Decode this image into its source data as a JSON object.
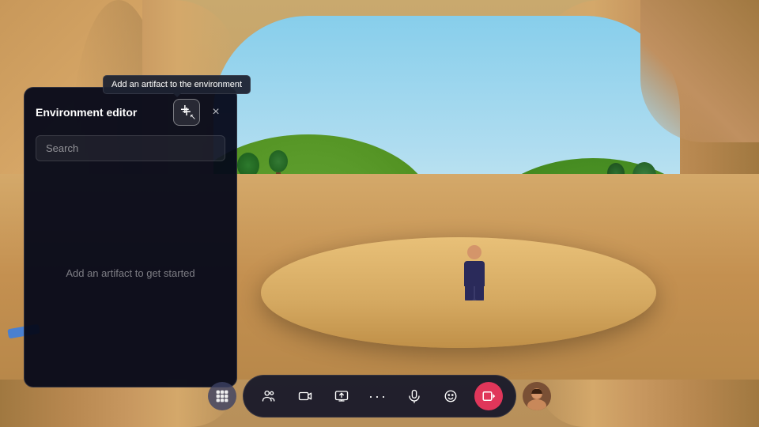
{
  "scene": {
    "bg_color": "#c9a96e"
  },
  "tooltip": {
    "text": "Add an artifact to the environment"
  },
  "env_panel": {
    "title": "Environment editor",
    "add_button_label": "+",
    "close_button_label": "×",
    "search_placeholder": "Search",
    "empty_state_text": "Add an artifact to get started"
  },
  "toolbar": {
    "apps_icon": "⊞",
    "people_icon": "👥",
    "media_icon": "🎬",
    "share_icon": "📋",
    "more_icon": "···",
    "mic_icon": "🎙",
    "emoji_icon": "🙂",
    "record_icon": "⏺",
    "avatar_title": "User avatar"
  }
}
